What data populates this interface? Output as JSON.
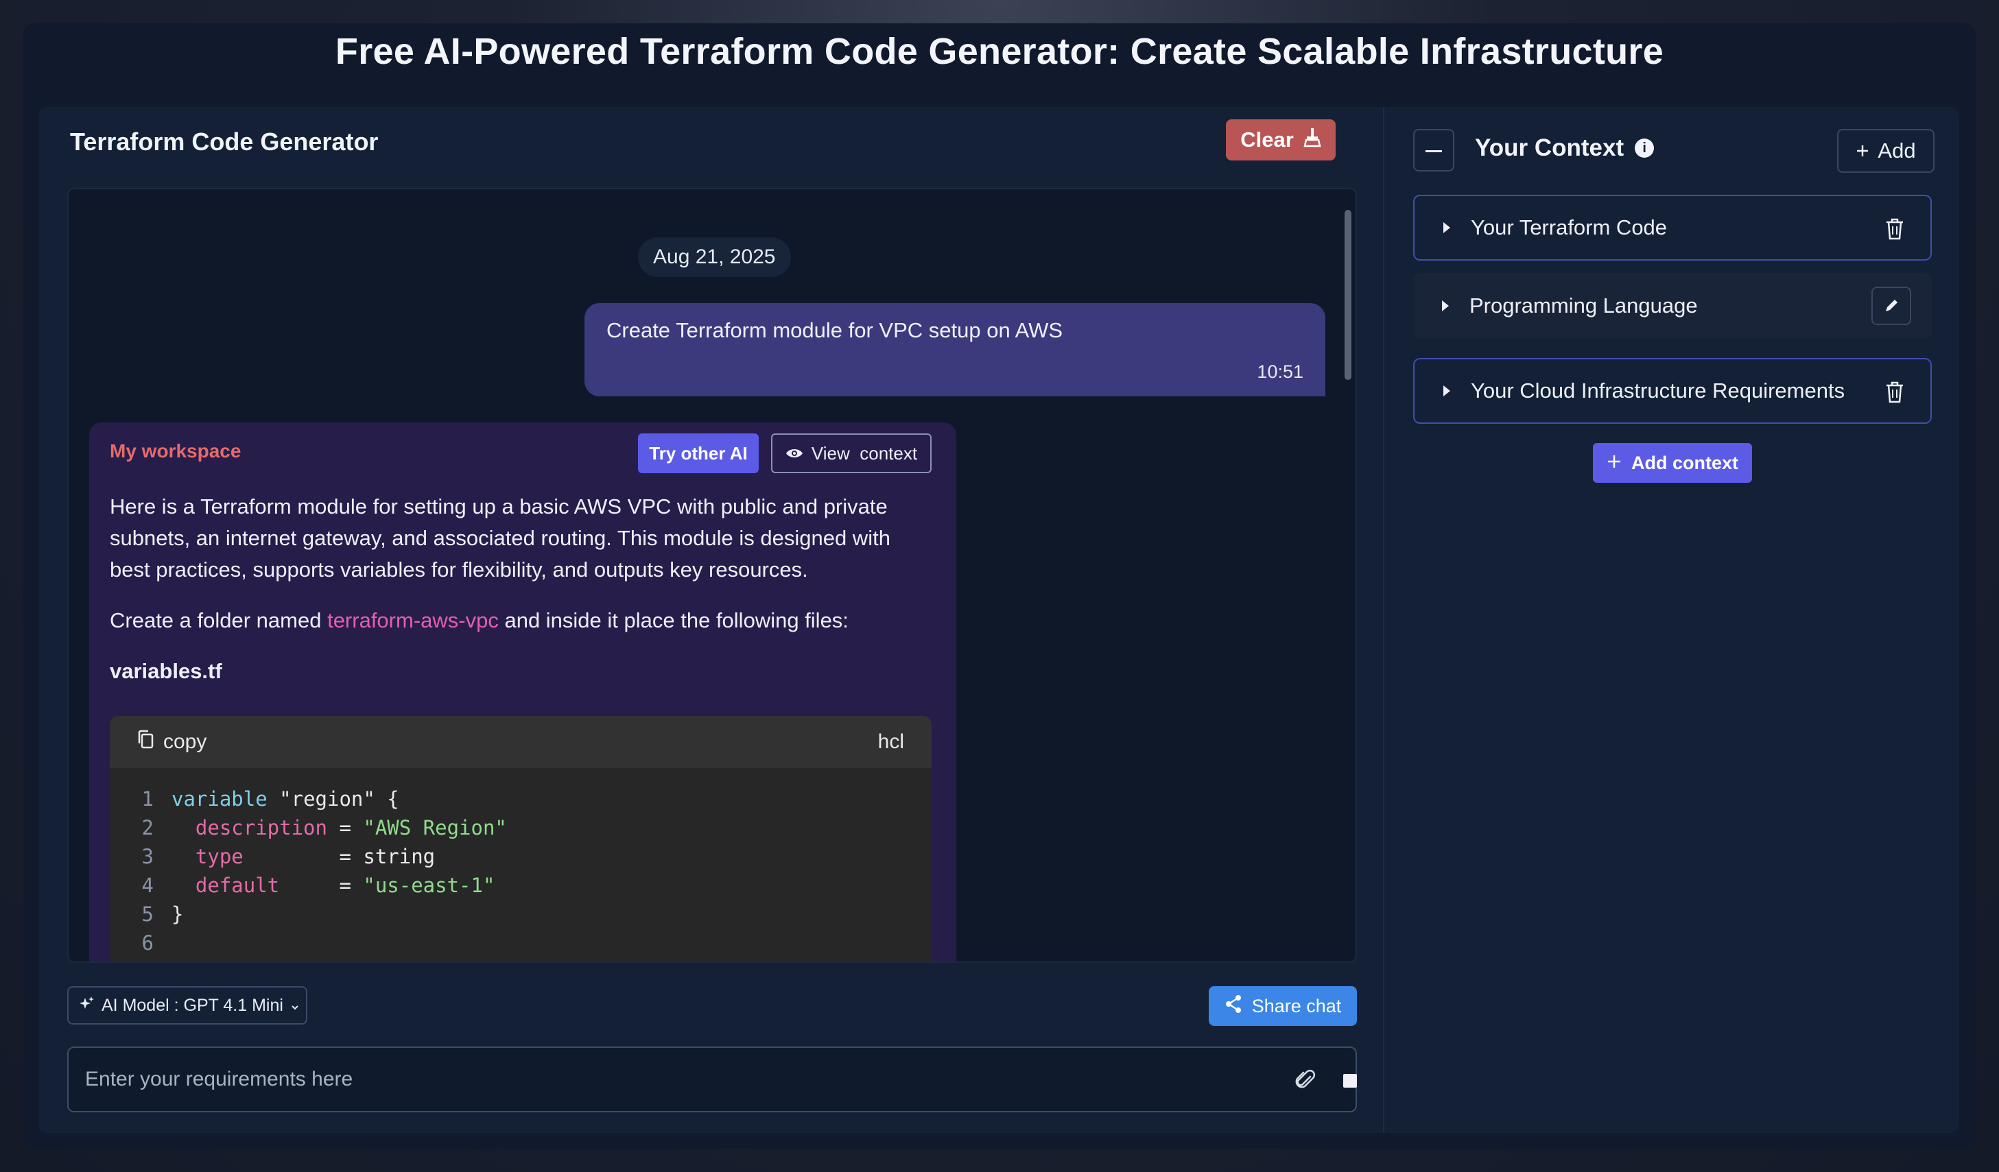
{
  "page": {
    "title": "Free AI-Powered Terraform Code Generator: Create Scalable Infrastructure"
  },
  "generator": {
    "title": "Terraform Code Generator",
    "clear_label": "Clear"
  },
  "chat": {
    "date": "Aug 21, 2025",
    "user_message": {
      "text": "Create Terraform module for VPC setup on AWS",
      "time": "10:51"
    },
    "ai_message": {
      "workspace_label": "My workspace",
      "try_other_ai_label": "Try other AI",
      "view_context_label": "View  context",
      "paragraph1": "Here is a Terraform module for setting up a basic AWS VPC with public and private subnets, an internet gateway, and associated routing. This module is designed with best practices, supports variables for flexibility, and outputs key resources.",
      "paragraph2_before": "Create a folder named ",
      "paragraph2_code": "terraform-aws-vpc",
      "paragraph2_after": " and inside it place the following files:",
      "filename": "variables.tf",
      "code": {
        "copy_label": "copy",
        "language": "hcl",
        "lines": [
          {
            "num": "1",
            "tokens": [
              {
                "t": "variable",
                "c": "kw"
              },
              {
                "t": " \"region\" {",
                "c": "plain"
              }
            ]
          },
          {
            "num": "2",
            "tokens": [
              {
                "t": "  description",
                "c": "attr"
              },
              {
                "t": " = ",
                "c": "plain"
              },
              {
                "t": "\"AWS Region\"",
                "c": "str"
              }
            ]
          },
          {
            "num": "3",
            "tokens": [
              {
                "t": "  type",
                "c": "attr"
              },
              {
                "t": "        = string",
                "c": "plain"
              }
            ]
          },
          {
            "num": "4",
            "tokens": [
              {
                "t": "  default",
                "c": "attr"
              },
              {
                "t": "     = ",
                "c": "plain"
              },
              {
                "t": "\"us-east-1\"",
                "c": "str"
              }
            ]
          },
          {
            "num": "5",
            "tokens": [
              {
                "t": "}",
                "c": "plain"
              }
            ]
          },
          {
            "num": "6",
            "tokens": []
          }
        ]
      }
    }
  },
  "footer": {
    "model_label": "AI Model : GPT 4.1 Mini",
    "share_label": "Share chat",
    "input_placeholder": "Enter your requirements here"
  },
  "context": {
    "title": "Your Context",
    "add_label": "Add",
    "items": [
      {
        "label": "Your Terraform Code",
        "action": "trash-icon"
      },
      {
        "label": "Programming Language",
        "action": "pencil-icon"
      },
      {
        "label": "Your Cloud Infrastructure Requirements",
        "action": "trash-icon"
      }
    ],
    "add_context_label": "Add context"
  },
  "colors": {
    "accent": "#5b5be6",
    "clear": "#b95555",
    "share": "#3b86e6",
    "user_bubble": "#3a3a7c",
    "ai_card": "#261d4b"
  }
}
